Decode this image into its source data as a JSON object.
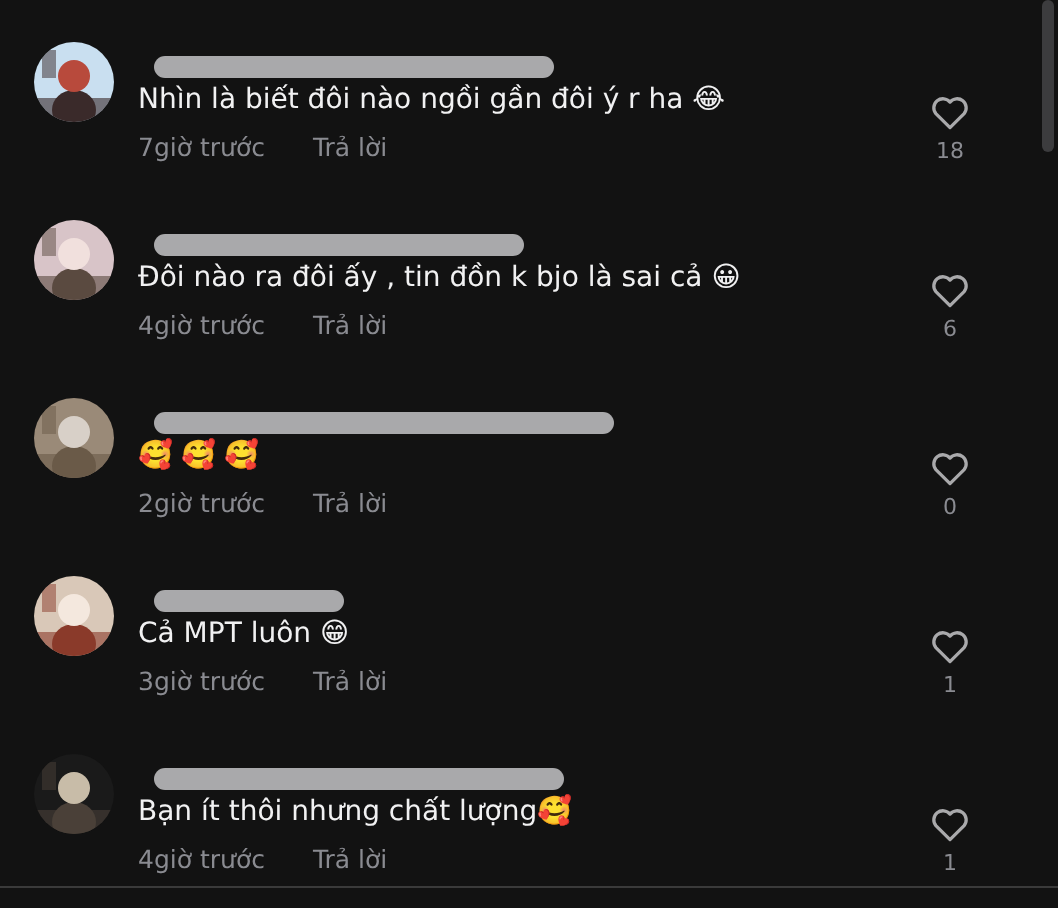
{
  "comments": [
    {
      "name_hidden": true,
      "text": "Nhìn là biết đôi nào ngồi gần đôi ý r ha 😂",
      "time": "7giờ trước",
      "reply": "Trả lời",
      "likes": "18"
    },
    {
      "name_hidden": true,
      "text": "Đôi nào ra đôi ấy , tin đồn k bjo là sai cả 😀",
      "time": "4giờ trước",
      "reply": "Trả lời",
      "likes": "6"
    },
    {
      "name_hidden": true,
      "text": "🥰 🥰 🥰",
      "time": "2giờ trước",
      "reply": "Trả lời",
      "likes": "0"
    },
    {
      "name_hidden": true,
      "text": "Cả MPT luôn 😁",
      "time": "3giờ trước",
      "reply": "Trả lời",
      "likes": "1"
    },
    {
      "name_hidden": true,
      "text": "Bạn ít thôi nhưng chất lượng🥰",
      "time": "4giờ trước",
      "reply": "Trả lời",
      "likes": "1"
    }
  ]
}
